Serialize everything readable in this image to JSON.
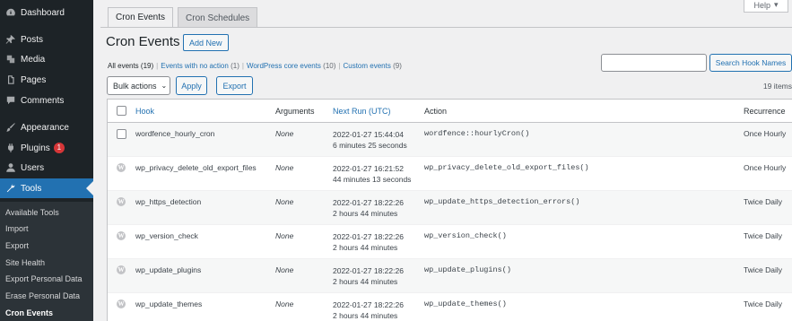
{
  "sidebar": {
    "items": [
      {
        "label": "Dashboard",
        "icon": "dashboard-icon"
      },
      {
        "label": "Posts",
        "icon": "pin-icon"
      },
      {
        "label": "Media",
        "icon": "media-icon"
      },
      {
        "label": "Pages",
        "icon": "pages-icon"
      },
      {
        "label": "Comments",
        "icon": "comment-icon"
      },
      {
        "label": "Appearance",
        "icon": "brush-icon"
      },
      {
        "label": "Plugins",
        "icon": "plug-icon",
        "badge": "1"
      },
      {
        "label": "Users",
        "icon": "user-icon"
      },
      {
        "label": "Tools",
        "icon": "wrench-icon",
        "current": true
      }
    ],
    "submenu": [
      {
        "label": "Available Tools"
      },
      {
        "label": "Import"
      },
      {
        "label": "Export"
      },
      {
        "label": "Site Health"
      },
      {
        "label": "Export Personal Data"
      },
      {
        "label": "Erase Personal Data"
      },
      {
        "label": "Cron Events",
        "current": true
      }
    ]
  },
  "help": {
    "label": "Help",
    "icon": "caret-down-icon"
  },
  "tabs": [
    {
      "label": "Cron Events",
      "active": true
    },
    {
      "label": "Cron Schedules",
      "active": false
    }
  ],
  "page": {
    "title": "Cron Events",
    "add_new": "Add New"
  },
  "views": [
    {
      "label": "All events",
      "count": "(19)"
    },
    {
      "label": "Events with no action",
      "count": "(1)"
    },
    {
      "label": "WordPress core events",
      "count": "(10)"
    },
    {
      "label": "Custom events",
      "count": "(9)"
    }
  ],
  "search": {
    "placeholder": "",
    "button": "Search Hook Names"
  },
  "bulk": {
    "label": "Bulk actions",
    "apply": "Apply",
    "export": "Export"
  },
  "items_count": "19 items",
  "table": {
    "columns": {
      "hook": "Hook",
      "arguments": "Arguments",
      "next_run": "Next Run (UTC)",
      "action": "Action",
      "recurrence": "Recurrence"
    },
    "rows": [
      {
        "hook": "wordfence_hourly_cron",
        "args": "None",
        "next_run": "2022-01-27 15:44:04",
        "next_rel": "6 minutes 25 seconds",
        "action": "wordfence::hourlyCron()",
        "recurrence": "Once Hourly",
        "core": false
      },
      {
        "hook": "wp_privacy_delete_old_export_files",
        "args": "None",
        "next_run": "2022-01-27 16:21:52",
        "next_rel": "44 minutes 13 seconds",
        "action": "wp_privacy_delete_old_export_files()",
        "recurrence": "Once Hourly",
        "core": true
      },
      {
        "hook": "wp_https_detection",
        "args": "None",
        "next_run": "2022-01-27 18:22:26",
        "next_rel": "2 hours 44 minutes",
        "action": "wp_update_https_detection_errors()",
        "recurrence": "Twice Daily",
        "core": true
      },
      {
        "hook": "wp_version_check",
        "args": "None",
        "next_run": "2022-01-27 18:22:26",
        "next_rel": "2 hours 44 minutes",
        "action": "wp_version_check()",
        "recurrence": "Twice Daily",
        "core": true
      },
      {
        "hook": "wp_update_plugins",
        "args": "None",
        "next_run": "2022-01-27 18:22:26",
        "next_rel": "2 hours 44 minutes",
        "action": "wp_update_plugins()",
        "recurrence": "Twice Daily",
        "core": true
      },
      {
        "hook": "wp_update_themes",
        "args": "None",
        "next_run": "2022-01-27 18:22:26",
        "next_rel": "2 hours 44 minutes",
        "action": "wp_update_themes()",
        "recurrence": "Twice Daily",
        "core": true
      }
    ]
  },
  "colors": {
    "sidebar_bg": "#1d2327",
    "accent": "#2271b1",
    "badge": "#d63638"
  }
}
